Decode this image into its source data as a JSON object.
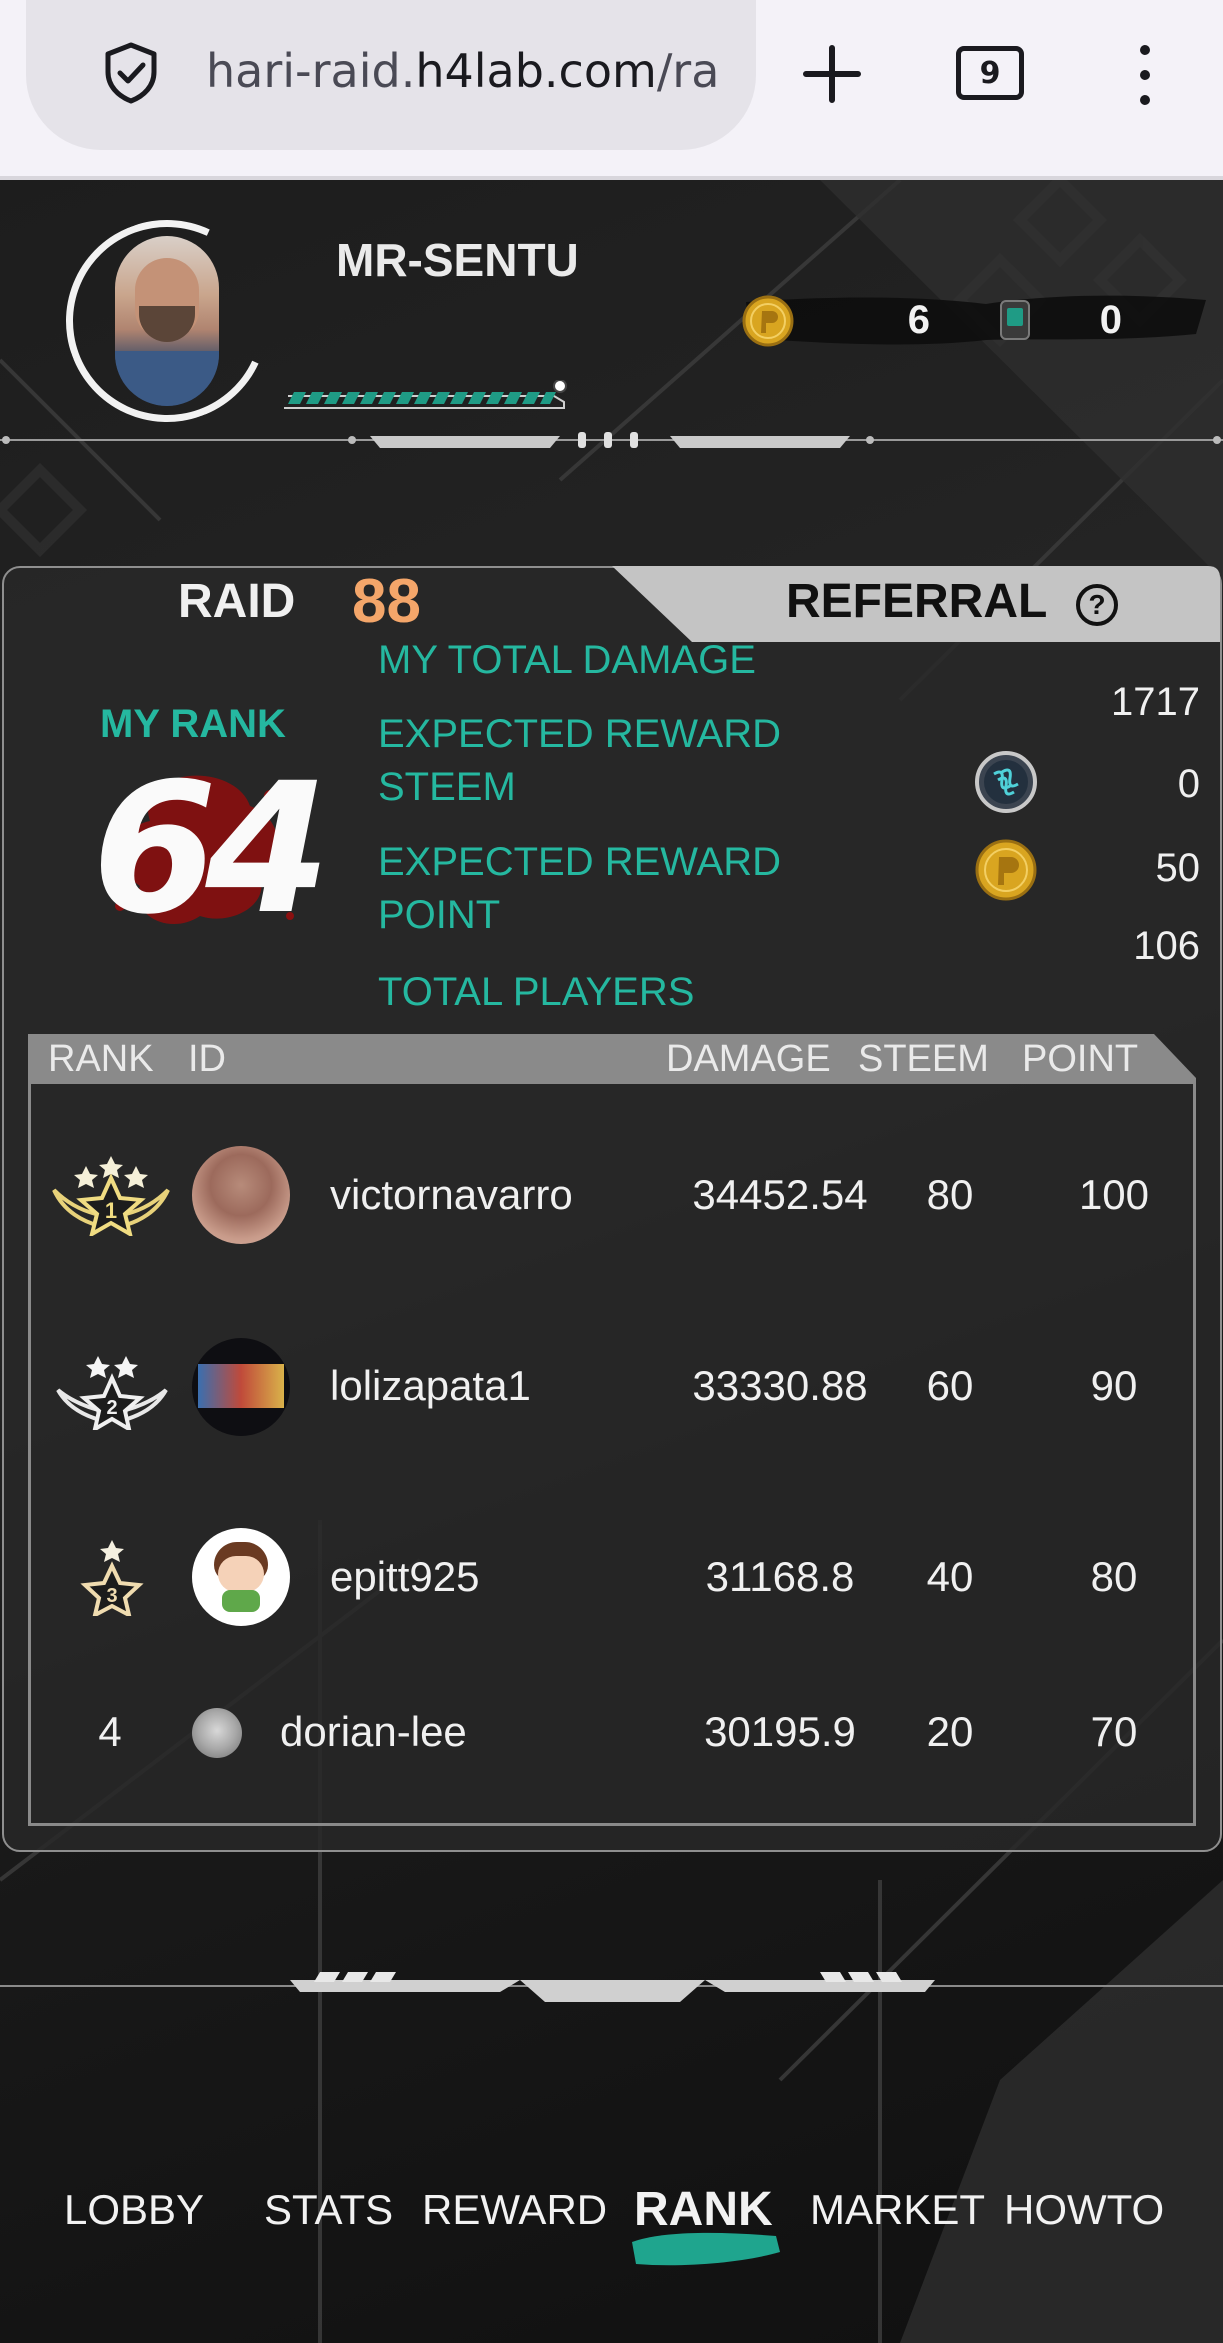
{
  "browser": {
    "url_prefix": "hari-raid.",
    "url_domain": "h4lab.com",
    "url_suffix": "/ra",
    "tab_count": "9",
    "icons": [
      "shield-icon",
      "plus-icon",
      "tabs-icon",
      "more-vert-icon"
    ]
  },
  "profile": {
    "username": "MR-SENTU",
    "coins": "6",
    "tickets": "0"
  },
  "tabs": {
    "raid_label": "RAID",
    "raid_number": "88",
    "referral_label": "REFERRAL"
  },
  "summary": {
    "my_rank_label": "MY RANK",
    "my_rank_value": "64",
    "total_damage_label": "MY TOTAL DAMAGE",
    "total_damage_value": "1717",
    "reward_steem_label": "EXPECTED REWARD STEEM",
    "reward_steem_value": "0",
    "reward_point_label": "EXPECTED REWARD POINT",
    "reward_point_value": "50",
    "total_players_label": "TOTAL PLAYERS",
    "total_players_value": "106"
  },
  "table": {
    "headers": {
      "rank": "RANK",
      "id": "ID",
      "damage": "DAMAGE",
      "steem": "STEEM",
      "point": "POINT"
    },
    "rows": [
      {
        "rank": "1",
        "id": "victornavarro",
        "damage": "34452.54",
        "steem": "80",
        "point": "100"
      },
      {
        "rank": "2",
        "id": "lolizapata1",
        "damage": "33330.88",
        "steem": "60",
        "point": "90"
      },
      {
        "rank": "3",
        "id": "epitt925",
        "damage": "31168.8",
        "steem": "40",
        "point": "80"
      },
      {
        "rank": "4",
        "id": "dorian-lee",
        "damage": "30195.9",
        "steem": "20",
        "point": "70"
      }
    ]
  },
  "nav": {
    "items": [
      "LOBBY",
      "STATS",
      "REWARD",
      "RANK",
      "MARKET",
      "HOWTO"
    ],
    "active": "RANK"
  },
  "colors": {
    "accent_teal": "#25b8a0",
    "raid_number": "#f4a66a",
    "coin_gold": "#d9a520"
  }
}
